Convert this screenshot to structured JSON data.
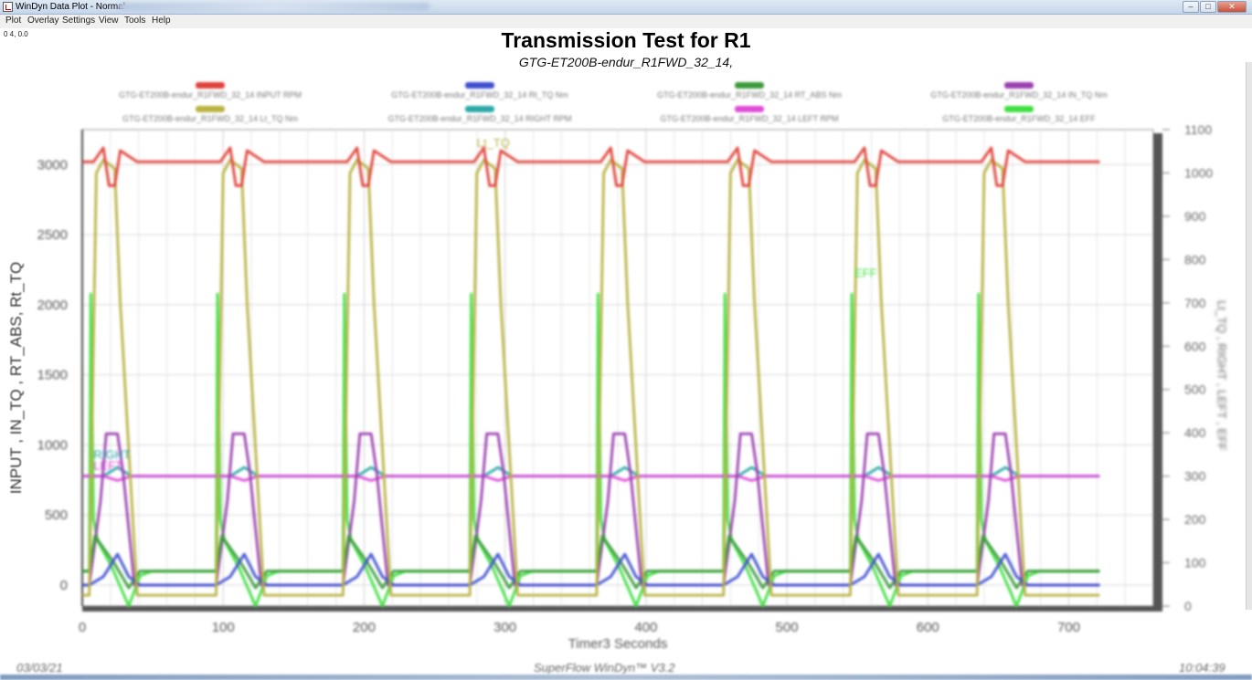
{
  "window": {
    "title": "WinDyn Data Plot - Normal",
    "buttons": {
      "minimize": "–",
      "maximize": "□",
      "close": "✕"
    }
  },
  "menu": [
    "Plot",
    "Overlay",
    "Settings",
    "View",
    "Tools",
    "Help"
  ],
  "cursor_readout": "0 4, 0.0",
  "footer": {
    "date": "03/03/21",
    "brand": "SuperFlow WinDyn™ V3.2",
    "time": "10:04:39"
  },
  "colors": {
    "input_rpm": "#e0413a",
    "lt_tq": "#b9b241",
    "rt_tq": "#3f4fd0",
    "right_rpm": "#2aa8a8",
    "rt_abs": "#3a9a3a",
    "left_rpm": "#e04bd8",
    "rt_abs_tq": "#9a40b0",
    "eff": "#3ee040"
  },
  "chart_data": {
    "type": "line",
    "title": "Transmission Test for R1",
    "subtitle": "GTG-ET200B-endur_R1FWD_32_14,",
    "xlabel": "Timer3 Seconds",
    "ylabel_left": "INPUT , IN_TQ , RT_ABS, Rt_TQ",
    "ylabel_right": "Lt_TQ , RIGHT , LEFT , EFF",
    "xlim": [
      0,
      760
    ],
    "ylim_left": [
      -150,
      3250
    ],
    "ylim_right": [
      0,
      1100
    ],
    "x_ticks": [
      0,
      100,
      200,
      300,
      400,
      500,
      600,
      700
    ],
    "y_ticks_left": [
      0,
      500,
      1000,
      1500,
      2000,
      2500,
      3000
    ],
    "y_ticks_right": [
      0,
      100,
      200,
      300,
      400,
      500,
      600,
      700,
      800,
      900,
      1000,
      1100
    ],
    "grid": true,
    "legend_position": "top",
    "cycle_starts": [
      5,
      95,
      185,
      275,
      365,
      455,
      545,
      635
    ],
    "x_end": 723,
    "series_labels": [
      "Lt_TQ",
      "EFF",
      "RIGHT",
      "LEFT"
    ],
    "series": [
      {
        "name": "GTG-ET200B-endur_R1FWD_32_14 INPUT RPM",
        "axis": "left",
        "color_key": "input_rpm",
        "cycle": {
          "x": [
            0,
            3,
            10,
            14,
            18,
            22,
            34
          ],
          "y": [
            3020,
            3020,
            3120,
            2850,
            2850,
            3100,
            3020
          ]
        },
        "baseline": 3020
      },
      {
        "name": "GTG-ET200B-endur_R1FWD_32_14 Rt_TQ Nm",
        "axis": "left",
        "color_key": "rt_tq",
        "cycle": {
          "x": [
            0,
            10,
            20,
            28,
            36
          ],
          "y": [
            0,
            60,
            220,
            60,
            0
          ]
        },
        "baseline": 0
      },
      {
        "name": "GTG-ET200B-endur_R1FWD_32_14 RT_ABS Nm",
        "axis": "left",
        "color_key": "rt_abs",
        "cycle": {
          "x": [
            0,
            4,
            18,
            28,
            36
          ],
          "y": [
            100,
            350,
            150,
            -20,
            100
          ]
        },
        "baseline": 100
      },
      {
        "name": "GTG-ET200B-endur_R1FWD_32_14 IN_TQ Nm",
        "axis": "left",
        "color_key": "rt_abs_tq",
        "cycle": {
          "x": [
            0,
            8,
            12,
            20,
            24,
            32,
            36
          ],
          "y": [
            0,
            600,
            1080,
            1080,
            800,
            0,
            0
          ]
        },
        "baseline": 0
      },
      {
        "name": "GTG-ET200B-endur_R1FWD_32_14 Lt_TQ Nm",
        "axis": "right",
        "color_key": "lt_tq",
        "cycle": {
          "x": [
            0,
            5,
            10,
            18,
            22,
            34,
            40
          ],
          "y": [
            25,
            1000,
            1030,
            1010,
            700,
            25,
            25
          ]
        },
        "baseline": 25
      },
      {
        "name": "GTG-ET200B-endur_R1FWD_32_14 RIGHT RPM",
        "axis": "right",
        "color_key": "right_rpm",
        "cycle": {
          "x": [
            0,
            10,
            20,
            30
          ],
          "y": [
            300,
            300,
            320,
            300
          ]
        },
        "baseline": 300
      },
      {
        "name": "GTG-ET200B-endur_R1FWD_32_14 LEFT RPM",
        "axis": "right",
        "color_key": "left_rpm",
        "cycle": {
          "x": [
            0,
            10,
            20,
            30
          ],
          "y": [
            300,
            300,
            290,
            300
          ]
        },
        "baseline": 300
      },
      {
        "name": "GTG-ET200B-endur_R1FWD_32_14 EFF",
        "axis": "right",
        "color_key": "eff",
        "cycle": {
          "x": [
            0,
            1,
            3,
            6,
            16,
            28,
            36,
            44
          ],
          "y": [
            80,
            720,
            200,
            150,
            90,
            0,
            70,
            80
          ]
        },
        "baseline": 80
      }
    ]
  }
}
